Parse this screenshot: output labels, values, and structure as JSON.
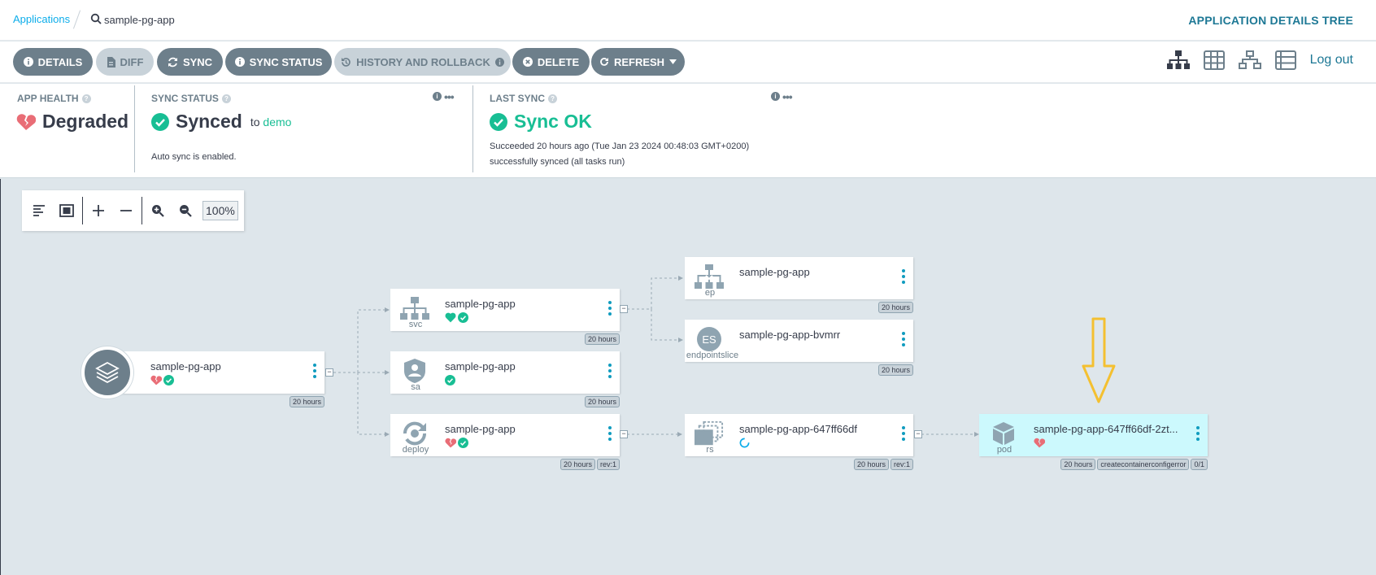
{
  "breadcrumb": {
    "root": "Applications",
    "current": "sample-pg-app"
  },
  "page_title": "APPLICATION DETAILS TREE",
  "toolbar": {
    "details": "DETAILS",
    "diff": "DIFF",
    "sync": "SYNC",
    "sync_status": "SYNC STATUS",
    "history": "HISTORY AND ROLLBACK",
    "delete": "DELETE",
    "refresh": "REFRESH",
    "logout": "Log out"
  },
  "status": {
    "app_health": {
      "heading": "APP HEALTH",
      "value": "Degraded"
    },
    "sync_status": {
      "heading": "SYNC STATUS",
      "value": "Synced",
      "to_label": "to",
      "target": "demo",
      "note": "Auto sync is enabled."
    },
    "last_sync": {
      "heading": "LAST SYNC",
      "value": "Sync OK",
      "line1": "Succeeded 20 hours ago (Tue Jan 23 2024 00:48:03 GMT+0200)",
      "line2": "successfully synced (all tasks run)"
    }
  },
  "graph_tools": {
    "zoom": "100%"
  },
  "nodes": {
    "app": {
      "name": "sample-pg-app",
      "age": "20 hours"
    },
    "svc": {
      "name": "sample-pg-app",
      "kind": "svc",
      "age": "20 hours"
    },
    "sa": {
      "name": "sample-pg-app",
      "kind": "sa",
      "age": "20 hours"
    },
    "deploy": {
      "name": "sample-pg-app",
      "kind": "deploy",
      "age": "20 hours",
      "rev": "rev:1"
    },
    "ep": {
      "name": "sample-pg-app",
      "kind": "ep",
      "age": "20 hours"
    },
    "endpointslice": {
      "name": "sample-pg-app-bvmrr",
      "kind": "endpointslice",
      "icon_text": "ES",
      "age": "20 hours"
    },
    "rs": {
      "name": "sample-pg-app-647ff66df",
      "kind": "rs",
      "age": "20 hours",
      "rev": "rev:1"
    },
    "pod": {
      "name": "sample-pg-app-647ff66df-2zt...",
      "kind": "pod",
      "age": "20 hours",
      "reason": "createcontainerconfigerror",
      "ready": "0/1"
    }
  },
  "colors": {
    "healthy": "#18be94",
    "degraded": "#e96d76",
    "link": "#0dadea",
    "annotation_arrow": "#f4c030"
  }
}
